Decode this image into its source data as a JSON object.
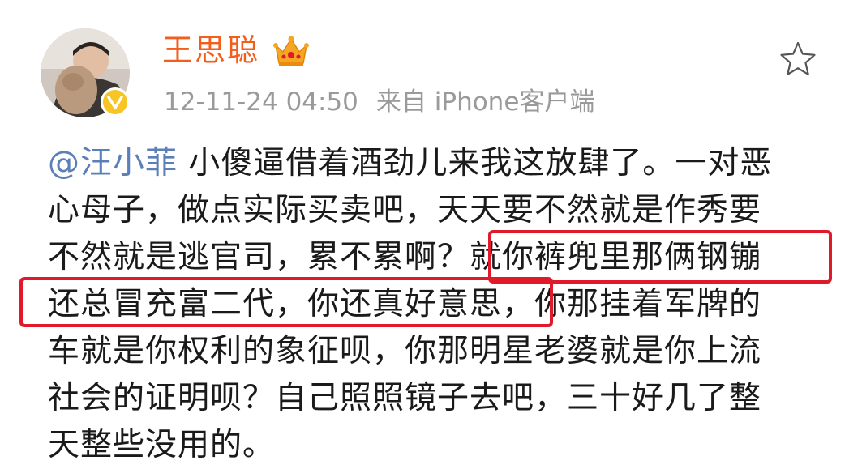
{
  "post": {
    "username": "王思聪",
    "timestamp": "12-11-24 04:50",
    "source": "来自 iPhone客户端",
    "favorite_icon": "star-outline-icon",
    "verified_icon": "verified-v-badge-icon",
    "crown_icon": "crown-icon",
    "mention": "@汪小菲",
    "lines": [
      " 小傻逼借着酒劲儿来我这放肆了。一对恶",
      "心母子，做点实际买卖吧，天天要不然就是作秀要",
      "不然就是逃官司，累不累啊？就你裤兜里那俩钢镚",
      "还总冒充富二代，你还真好意思，你那挂着军牌的",
      "车就是你权利的象征呗，你那明星老婆就是你上流",
      "社会的证明呗？自己照照镜子去吧，三十好几了整",
      "天整些没用的。"
    ]
  },
  "colors": {
    "username": "#f25e1c",
    "mention": "#5b7fb6",
    "meta": "#9a9a9a",
    "highlight_box": "#e0192b",
    "verified": "#f7c524"
  }
}
